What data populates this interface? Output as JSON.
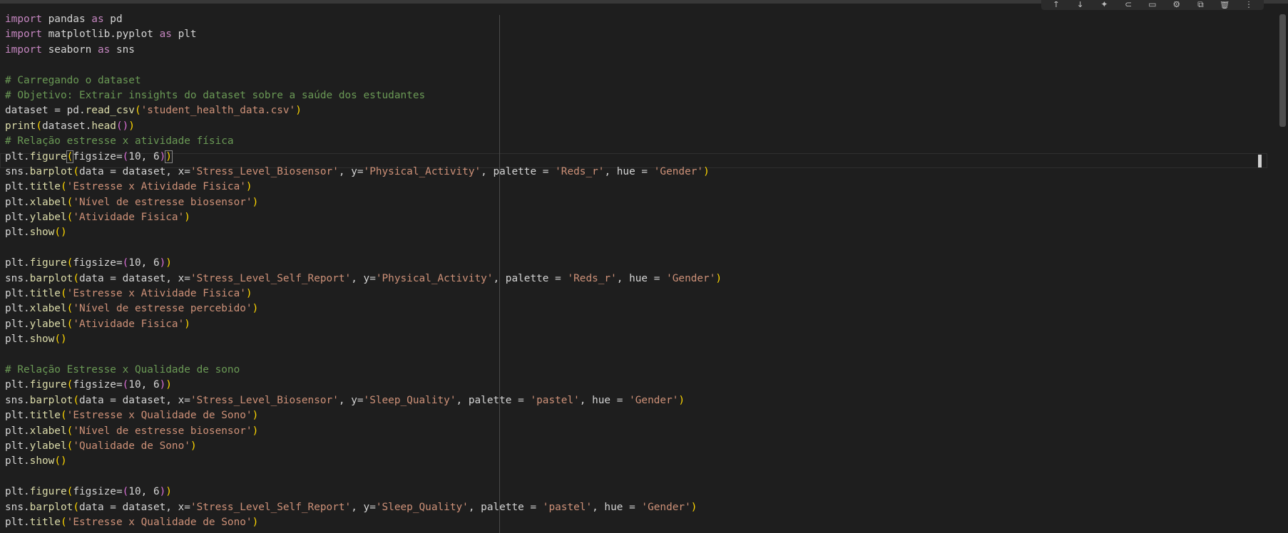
{
  "toolbar": {
    "buttons": [
      {
        "name": "move-up-icon",
        "glyph": "↑"
      },
      {
        "name": "move-down-icon",
        "glyph": "↓"
      },
      {
        "name": "sparkle-icon",
        "glyph": "✦"
      },
      {
        "name": "link-icon",
        "glyph": "⊂"
      },
      {
        "name": "comment-icon",
        "glyph": "▭"
      },
      {
        "name": "gear-icon",
        "glyph": "⚙"
      },
      {
        "name": "open-external-icon",
        "glyph": "⧉"
      },
      {
        "name": "trash-icon",
        "glyph": "🗑"
      },
      {
        "name": "more-options-icon",
        "glyph": "⋮"
      }
    ]
  },
  "code_lines": [
    [
      {
        "t": "import",
        "c": "kw"
      },
      {
        "t": " pandas ",
        "c": "id"
      },
      {
        "t": "as",
        "c": "kw"
      },
      {
        "t": " pd",
        "c": "id"
      }
    ],
    [
      {
        "t": "import",
        "c": "kw"
      },
      {
        "t": " matplotlib.pyplot ",
        "c": "id"
      },
      {
        "t": "as",
        "c": "kw"
      },
      {
        "t": " plt",
        "c": "id"
      }
    ],
    [
      {
        "t": "import",
        "c": "kw"
      },
      {
        "t": " seaborn ",
        "c": "id"
      },
      {
        "t": "as",
        "c": "kw"
      },
      {
        "t": " sns",
        "c": "id"
      }
    ],
    [],
    [
      {
        "t": "# Carregando o dataset",
        "c": "cm"
      }
    ],
    [
      {
        "t": "# Objetivo: Extrair insights do dataset sobre a saúde dos estudantes",
        "c": "cm"
      }
    ],
    [
      {
        "t": "dataset = pd.",
        "c": "id"
      },
      {
        "t": "read_csv",
        "c": "fn"
      },
      {
        "t": "(",
        "c": "br"
      },
      {
        "t": "'student_health_data.csv'",
        "c": "str"
      },
      {
        "t": ")",
        "c": "br"
      }
    ],
    [
      {
        "t": "print",
        "c": "fn"
      },
      {
        "t": "(",
        "c": "br"
      },
      {
        "t": "dataset.",
        "c": "id"
      },
      {
        "t": "head",
        "c": "fn"
      },
      {
        "t": "()",
        "c": "br2"
      },
      {
        "t": ")",
        "c": "br"
      }
    ],
    [
      {
        "t": "# Relação estresse x atividade física",
        "c": "cm"
      }
    ],
    [
      {
        "t": "plt.",
        "c": "id"
      },
      {
        "t": "figure",
        "c": "fn"
      },
      {
        "t": "(",
        "c": "br",
        "m": true
      },
      {
        "t": "figsize=",
        "c": "id"
      },
      {
        "t": "(",
        "c": "br2"
      },
      {
        "t": "10, 6",
        "c": "id"
      },
      {
        "t": ")",
        "c": "br2"
      },
      {
        "t": ")",
        "c": "br",
        "m": true
      }
    ],
    [
      {
        "t": "sns.",
        "c": "id"
      },
      {
        "t": "barplot",
        "c": "fn"
      },
      {
        "t": "(",
        "c": "br"
      },
      {
        "t": "data = dataset, x=",
        "c": "id"
      },
      {
        "t": "'Stress_Level_Biosensor'",
        "c": "str"
      },
      {
        "t": ", y=",
        "c": "id"
      },
      {
        "t": "'Physical_Activity'",
        "c": "str"
      },
      {
        "t": ", palette = ",
        "c": "id"
      },
      {
        "t": "'Reds_r'",
        "c": "str"
      },
      {
        "t": ", hue = ",
        "c": "id"
      },
      {
        "t": "'Gender'",
        "c": "str"
      },
      {
        "t": ")",
        "c": "br"
      }
    ],
    [
      {
        "t": "plt.",
        "c": "id"
      },
      {
        "t": "title",
        "c": "fn"
      },
      {
        "t": "(",
        "c": "br"
      },
      {
        "t": "'Estresse x Atividade Fisica'",
        "c": "str"
      },
      {
        "t": ")",
        "c": "br"
      }
    ],
    [
      {
        "t": "plt.",
        "c": "id"
      },
      {
        "t": "xlabel",
        "c": "fn"
      },
      {
        "t": "(",
        "c": "br"
      },
      {
        "t": "'Nível de estresse biosensor'",
        "c": "str"
      },
      {
        "t": ")",
        "c": "br"
      }
    ],
    [
      {
        "t": "plt.",
        "c": "id"
      },
      {
        "t": "ylabel",
        "c": "fn"
      },
      {
        "t": "(",
        "c": "br"
      },
      {
        "t": "'Atividade Fisica'",
        "c": "str"
      },
      {
        "t": ")",
        "c": "br"
      }
    ],
    [
      {
        "t": "plt.",
        "c": "id"
      },
      {
        "t": "show",
        "c": "fn"
      },
      {
        "t": "()",
        "c": "br"
      }
    ],
    [],
    [
      {
        "t": "plt.",
        "c": "id"
      },
      {
        "t": "figure",
        "c": "fn"
      },
      {
        "t": "(",
        "c": "br"
      },
      {
        "t": "figsize=",
        "c": "id"
      },
      {
        "t": "(",
        "c": "br2"
      },
      {
        "t": "10, 6",
        "c": "id"
      },
      {
        "t": ")",
        "c": "br2"
      },
      {
        "t": ")",
        "c": "br"
      }
    ],
    [
      {
        "t": "sns.",
        "c": "id"
      },
      {
        "t": "barplot",
        "c": "fn"
      },
      {
        "t": "(",
        "c": "br"
      },
      {
        "t": "data = dataset, x=",
        "c": "id"
      },
      {
        "t": "'Stress_Level_Self_Report'",
        "c": "str"
      },
      {
        "t": ", y=",
        "c": "id"
      },
      {
        "t": "'Physical_Activity'",
        "c": "str"
      },
      {
        "t": ", palette = ",
        "c": "id"
      },
      {
        "t": "'Reds_r'",
        "c": "str"
      },
      {
        "t": ", hue = ",
        "c": "id"
      },
      {
        "t": "'Gender'",
        "c": "str"
      },
      {
        "t": ")",
        "c": "br"
      }
    ],
    [
      {
        "t": "plt.",
        "c": "id"
      },
      {
        "t": "title",
        "c": "fn"
      },
      {
        "t": "(",
        "c": "br"
      },
      {
        "t": "'Estresse x Atividade Fisica'",
        "c": "str"
      },
      {
        "t": ")",
        "c": "br"
      }
    ],
    [
      {
        "t": "plt.",
        "c": "id"
      },
      {
        "t": "xlabel",
        "c": "fn"
      },
      {
        "t": "(",
        "c": "br"
      },
      {
        "t": "'Nível de estresse percebido'",
        "c": "str"
      },
      {
        "t": ")",
        "c": "br"
      }
    ],
    [
      {
        "t": "plt.",
        "c": "id"
      },
      {
        "t": "ylabel",
        "c": "fn"
      },
      {
        "t": "(",
        "c": "br"
      },
      {
        "t": "'Atividade Fisica'",
        "c": "str"
      },
      {
        "t": ")",
        "c": "br"
      }
    ],
    [
      {
        "t": "plt.",
        "c": "id"
      },
      {
        "t": "show",
        "c": "fn"
      },
      {
        "t": "()",
        "c": "br"
      }
    ],
    [],
    [
      {
        "t": "# Relação Estresse x Qualidade de sono",
        "c": "cm"
      }
    ],
    [
      {
        "t": "plt.",
        "c": "id"
      },
      {
        "t": "figure",
        "c": "fn"
      },
      {
        "t": "(",
        "c": "br"
      },
      {
        "t": "figsize=",
        "c": "id"
      },
      {
        "t": "(",
        "c": "br2"
      },
      {
        "t": "10, 6",
        "c": "id"
      },
      {
        "t": ")",
        "c": "br2"
      },
      {
        "t": ")",
        "c": "br"
      }
    ],
    [
      {
        "t": "sns.",
        "c": "id"
      },
      {
        "t": "barplot",
        "c": "fn"
      },
      {
        "t": "(",
        "c": "br"
      },
      {
        "t": "data = dataset, x=",
        "c": "id"
      },
      {
        "t": "'Stress_Level_Biosensor'",
        "c": "str"
      },
      {
        "t": ", y=",
        "c": "id"
      },
      {
        "t": "'Sleep_Quality'",
        "c": "str"
      },
      {
        "t": ", palette = ",
        "c": "id"
      },
      {
        "t": "'pastel'",
        "c": "str"
      },
      {
        "t": ", hue = ",
        "c": "id"
      },
      {
        "t": "'Gender'",
        "c": "str"
      },
      {
        "t": ")",
        "c": "br"
      }
    ],
    [
      {
        "t": "plt.",
        "c": "id"
      },
      {
        "t": "title",
        "c": "fn"
      },
      {
        "t": "(",
        "c": "br"
      },
      {
        "t": "'Estresse x Qualidade de Sono'",
        "c": "str"
      },
      {
        "t": ")",
        "c": "br"
      }
    ],
    [
      {
        "t": "plt.",
        "c": "id"
      },
      {
        "t": "xlabel",
        "c": "fn"
      },
      {
        "t": "(",
        "c": "br"
      },
      {
        "t": "'Nível de estresse biosensor'",
        "c": "str"
      },
      {
        "t": ")",
        "c": "br"
      }
    ],
    [
      {
        "t": "plt.",
        "c": "id"
      },
      {
        "t": "ylabel",
        "c": "fn"
      },
      {
        "t": "(",
        "c": "br"
      },
      {
        "t": "'Qualidade de Sono'",
        "c": "str"
      },
      {
        "t": ")",
        "c": "br"
      }
    ],
    [
      {
        "t": "plt.",
        "c": "id"
      },
      {
        "t": "show",
        "c": "fn"
      },
      {
        "t": "()",
        "c": "br"
      }
    ],
    [],
    [
      {
        "t": "plt.",
        "c": "id"
      },
      {
        "t": "figure",
        "c": "fn"
      },
      {
        "t": "(",
        "c": "br"
      },
      {
        "t": "figsize=",
        "c": "id"
      },
      {
        "t": "(",
        "c": "br2"
      },
      {
        "t": "10, 6",
        "c": "id"
      },
      {
        "t": ")",
        "c": "br2"
      },
      {
        "t": ")",
        "c": "br"
      }
    ],
    [
      {
        "t": "sns.",
        "c": "id"
      },
      {
        "t": "barplot",
        "c": "fn"
      },
      {
        "t": "(",
        "c": "br"
      },
      {
        "t": "data = dataset, x=",
        "c": "id"
      },
      {
        "t": "'Stress_Level_Self_Report'",
        "c": "str"
      },
      {
        "t": ", y=",
        "c": "id"
      },
      {
        "t": "'Sleep_Quality'",
        "c": "str"
      },
      {
        "t": ", palette = ",
        "c": "id"
      },
      {
        "t": "'pastel'",
        "c": "str"
      },
      {
        "t": ", hue = ",
        "c": "id"
      },
      {
        "t": "'Gender'",
        "c": "str"
      },
      {
        "t": ")",
        "c": "br"
      }
    ],
    [
      {
        "t": "plt.",
        "c": "id"
      },
      {
        "t": "title",
        "c": "fn"
      },
      {
        "t": "(",
        "c": "br"
      },
      {
        "t": "'Estresse x Qualidade de Sono'",
        "c": "str"
      },
      {
        "t": ")",
        "c": "br"
      }
    ]
  ]
}
